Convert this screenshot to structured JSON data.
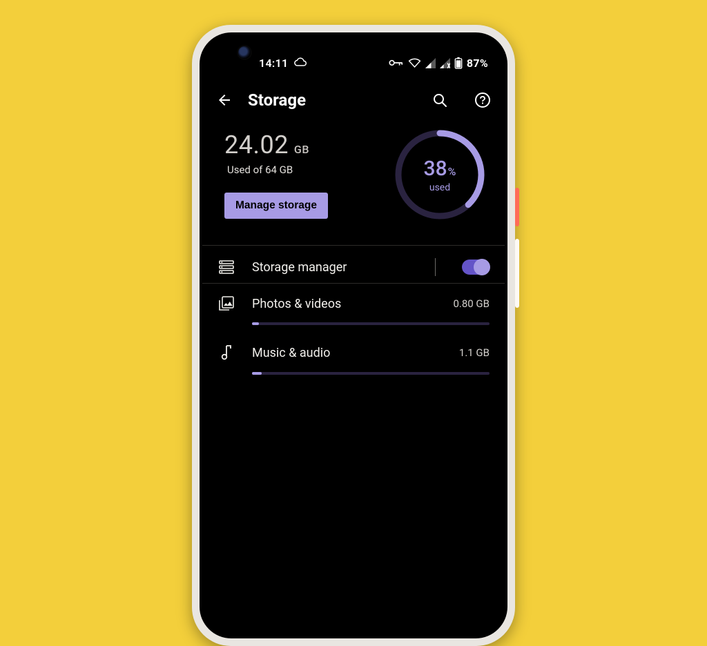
{
  "statusbar": {
    "time": "14:11",
    "battery_pct": "87%"
  },
  "appbar": {
    "title": "Storage"
  },
  "summary": {
    "used_value": "24.02",
    "used_unit": "GB",
    "subtitle": "Used of 64 GB",
    "manage_label": "Manage storage",
    "ring_pct": "38",
    "ring_pct_sign": "%",
    "ring_label": "used"
  },
  "rows": {
    "manager": {
      "label": "Storage manager",
      "toggle_on": true
    },
    "photos": {
      "label": "Photos & videos",
      "size": "0.80 GB",
      "bar_pct": 3
    },
    "music": {
      "label": "Music & audio",
      "size": "1.1 GB",
      "bar_pct": 4
    }
  },
  "colors": {
    "accent": "#a79be5"
  }
}
